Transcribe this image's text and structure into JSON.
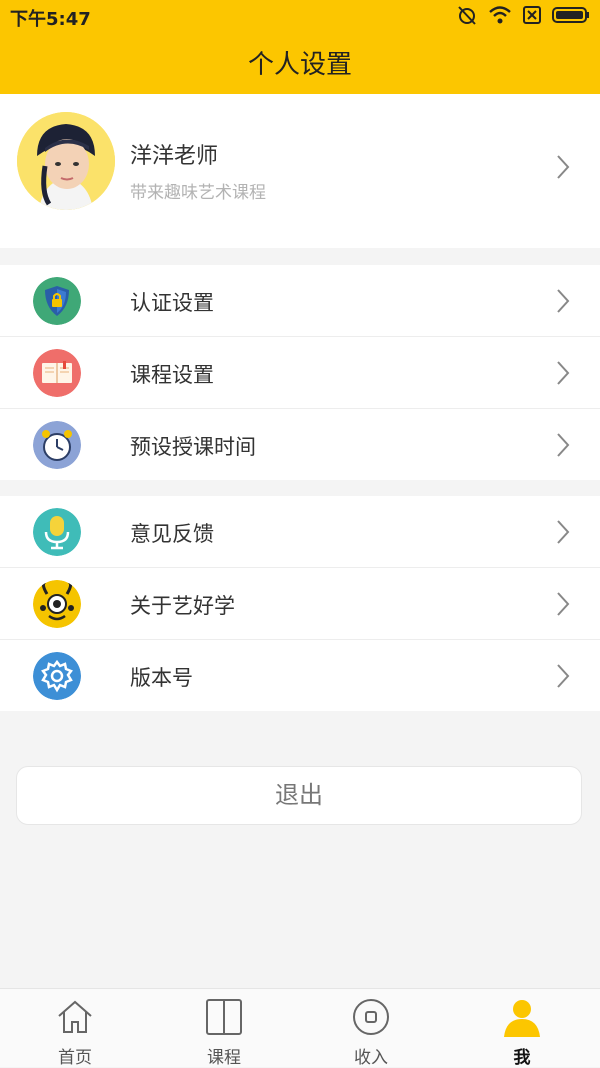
{
  "status_bar": {
    "time": "下午5:47"
  },
  "header": {
    "title": "个人设置"
  },
  "profile": {
    "name": "洋洋老师",
    "subtitle": "带来趣味艺术课程"
  },
  "groups": [
    {
      "items": [
        {
          "label": "认证设置",
          "icon": "shield-icon",
          "color": "#3fa877"
        },
        {
          "label": "课程设置",
          "icon": "book-icon",
          "color": "#ef6e6a"
        },
        {
          "label": "预设授课时间",
          "icon": "alarm-clock-icon",
          "color": "#8ca3d6"
        }
      ]
    },
    {
      "items": [
        {
          "label": "意见反馈",
          "icon": "microphone-icon",
          "color": "#3fbcb8"
        },
        {
          "label": "关于艺好学",
          "icon": "mascot-icon",
          "color": "#f5c400"
        },
        {
          "label": "版本号",
          "icon": "gear-icon",
          "color": "#3d8fd6"
        }
      ]
    }
  ],
  "logout": {
    "label": "退出"
  },
  "tabbar": {
    "tabs": [
      {
        "label": "首页",
        "icon": "home-icon"
      },
      {
        "label": "课程",
        "icon": "book-open-icon"
      },
      {
        "label": "收入",
        "icon": "coin-icon"
      },
      {
        "label": "我",
        "icon": "user-icon",
        "active": true
      }
    ],
    "accent_color": "#fcc600"
  },
  "theme": {
    "accent": "#fcc600"
  }
}
